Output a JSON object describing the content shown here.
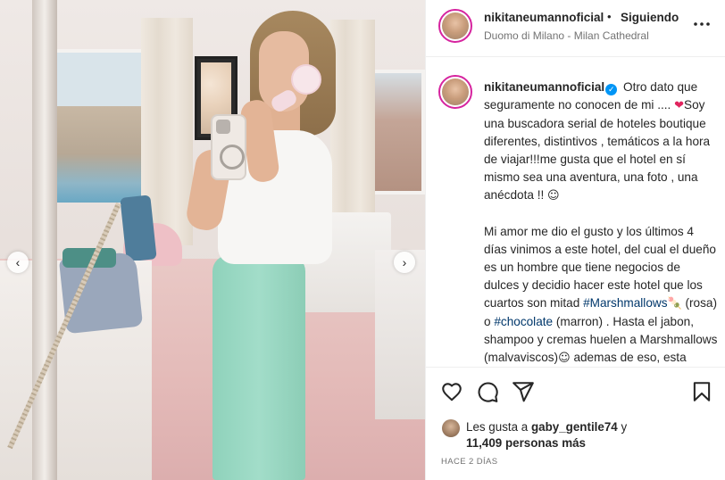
{
  "post": {
    "username": "nikitaneumannoficial",
    "separator": "•",
    "follow_status": "Siguiendo",
    "location": "Duomo di Milano - Milan Cathedral"
  },
  "caption": {
    "username": "nikitaneumannoficial",
    "p1_text": "Otro dato que seguramente no conocen de mi ....",
    "p1_heart": "❤",
    "p1_text2": "Soy una buscadora serial de hoteles boutique diferentes, distintivos , temáticos a la hora de viajar!!!me gusta que el hotel en sí mismo sea una aventura, una foto , una anécdota !!",
    "p1_emoji": "☺",
    "p2_text": "Mi amor me dio el gusto y los últimos 4 días vinimos a este hotel, del cual el dueño es un hombre que tiene negocios de dulces y decidio hacer este hotel que los cuartos son mitad",
    "hashtag1": "#Marshmallows",
    "p2_emoji1": "🍡",
    "p2_text2": "(rosa) o",
    "hashtag2": "#chocolate",
    "p2_text3": "(marron) . Hasta el jabon, shampoo y cremas huelen a Marshmallows (malvaviscos)",
    "p2_emoji2": "☺",
    "p2_text4": "ademas de eso, esta sobre la plaza del Duomo frente a la famosa galería Vittorio"
  },
  "likes": {
    "prefix": "Les gusta a",
    "user": "gaby_gentile74",
    "suffix": "y",
    "others": "11,409 personas más"
  },
  "timestamp": "HACE 2 DÍAS",
  "icons": {
    "more": "more-options-icon",
    "like": "heart-icon",
    "comment": "comment-icon",
    "share": "share-icon",
    "save": "bookmark-icon",
    "prev": "chevron-left-icon",
    "next": "chevron-right-icon",
    "verified": "verified-badge-icon"
  },
  "colors": {
    "accent_link": "#00376b",
    "verified": "#0095f6",
    "muted": "#737373",
    "text": "#262626"
  }
}
